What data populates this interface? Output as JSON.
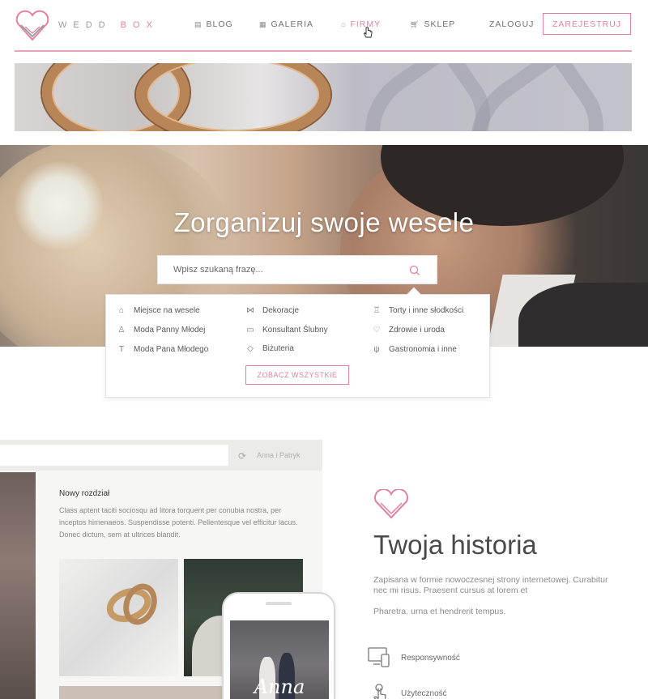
{
  "brand": {
    "part1": "WEDD",
    "part2": "BOX"
  },
  "nav": {
    "blog": "BLOG",
    "galeria": "GALERIA",
    "firmy": "FIRMY",
    "sklep": "SKLEP",
    "login": "ZALOGUJ",
    "register": "ZAREJESTRUJ"
  },
  "hero": {
    "title": "Zorganizuj swoje wesele",
    "search_placeholder": "Wpisz szukaną frazę..."
  },
  "categories": [
    {
      "label": "Miejsce na wesele",
      "icon": "house-icon"
    },
    {
      "label": "Moda Panny Młodej",
      "icon": "dress-icon"
    },
    {
      "label": "Moda Pana Młodego",
      "icon": "tie-icon"
    },
    {
      "label": "Dekoracje",
      "icon": "bow-icon"
    },
    {
      "label": "Konsultant Ślubny",
      "icon": "consultant-icon"
    },
    {
      "label": "Biżuteria",
      "icon": "diamond-icon"
    },
    {
      "label": "Torty i inne słodkości",
      "icon": "cake-icon"
    },
    {
      "label": "Zdrowie i uroda",
      "icon": "heart-icon"
    },
    {
      "label": "Gastronomia i inne",
      "icon": "cutlery-icon"
    }
  ],
  "see_all": "ZOBACZ WSZYSTKIE",
  "mockup": {
    "user": "Anna i Patryk",
    "chapter_title": "Nowy rozdział",
    "chapter_text": "Class aptent taciti sociosqu ad litora torquent per conubia nostra, per inceptos himenaeos. Suspendisse potenti. Pellentesque vel efficitur lacus. Donec dictum, sem at ultrices blandit.",
    "phone_name": "Anna"
  },
  "story": {
    "title": "Twoja historia",
    "text1": "Zapisana w formie nowoczesnej strony internetowej. Curabitur nec mi risus. Praesent cursus at lorem et",
    "text2": "Pharetra. urna et hendrerit tempus.",
    "features": [
      "Responsywność",
      "Użyteczność"
    ]
  },
  "colors": {
    "accent": "#e47fa4",
    "text": "#555555"
  }
}
